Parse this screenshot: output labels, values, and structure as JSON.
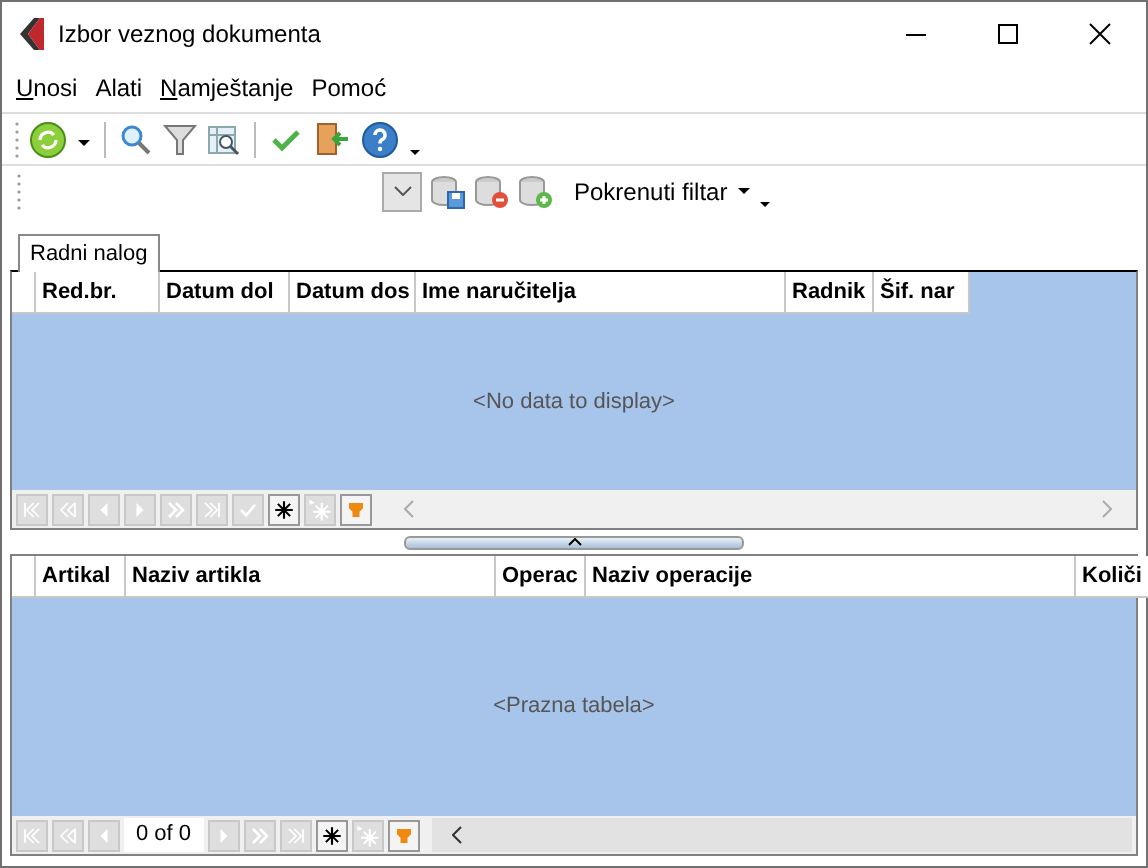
{
  "window": {
    "title": "Izbor veznog dokumenta"
  },
  "menu": [
    {
      "label": "Unosi",
      "mnemonic": true
    },
    {
      "label": "Alati",
      "mnemonic": false
    },
    {
      "label": "Namještanje",
      "mnemonic": true
    },
    {
      "label": "Pomoć",
      "mnemonic": false
    }
  ],
  "toolbar": [
    {
      "kind": "refresh"
    },
    {
      "kind": "caret"
    },
    {
      "kind": "sep"
    },
    {
      "kind": "search"
    },
    {
      "kind": "filter"
    },
    {
      "kind": "grid-search"
    },
    {
      "kind": "sep"
    },
    {
      "kind": "check"
    },
    {
      "kind": "exit"
    },
    {
      "kind": "help"
    },
    {
      "kind": "overflow"
    }
  ],
  "filter_bar": {
    "label": "Pokrenuti filtar"
  },
  "tabs": [
    {
      "label": "Radni nalog",
      "selected": true
    }
  ],
  "grids": [
    {
      "columns": [
        "Red.br.",
        "Datum dol",
        "Datum dos",
        "Ime naručitelja",
        "Radnik",
        "Šif. nar"
      ],
      "empty_text": "<No data to display>",
      "navigator": [
        {
          "kind": "first",
          "disabled": true
        },
        {
          "kind": "prev-page",
          "disabled": true
        },
        {
          "kind": "prev",
          "disabled": true
        },
        {
          "kind": "next",
          "disabled": true
        },
        {
          "kind": "next-page",
          "disabled": true
        },
        {
          "kind": "last",
          "disabled": true
        },
        {
          "kind": "confirm",
          "disabled": true
        },
        {
          "kind": "insert",
          "disabled": false
        },
        {
          "kind": "multi-insert",
          "disabled": true
        },
        {
          "kind": "filter",
          "disabled": false
        }
      ]
    },
    {
      "columns": [
        "Artikal",
        "Naziv artikla",
        "Operac",
        "Naziv operacije",
        "Količi"
      ],
      "empty_text": "<Prazna tabela>",
      "navigator": [
        {
          "kind": "first",
          "disabled": true
        },
        {
          "kind": "prev-page",
          "disabled": true
        },
        {
          "kind": "prev",
          "disabled": true
        },
        {
          "kind": "record",
          "text": "0 of 0"
        },
        {
          "kind": "next",
          "disabled": true
        },
        {
          "kind": "next-page",
          "disabled": true
        },
        {
          "kind": "last",
          "disabled": true
        },
        {
          "kind": "insert",
          "disabled": false
        },
        {
          "kind": "multi-insert",
          "disabled": true
        },
        {
          "kind": "filter",
          "disabled": false
        }
      ]
    }
  ]
}
